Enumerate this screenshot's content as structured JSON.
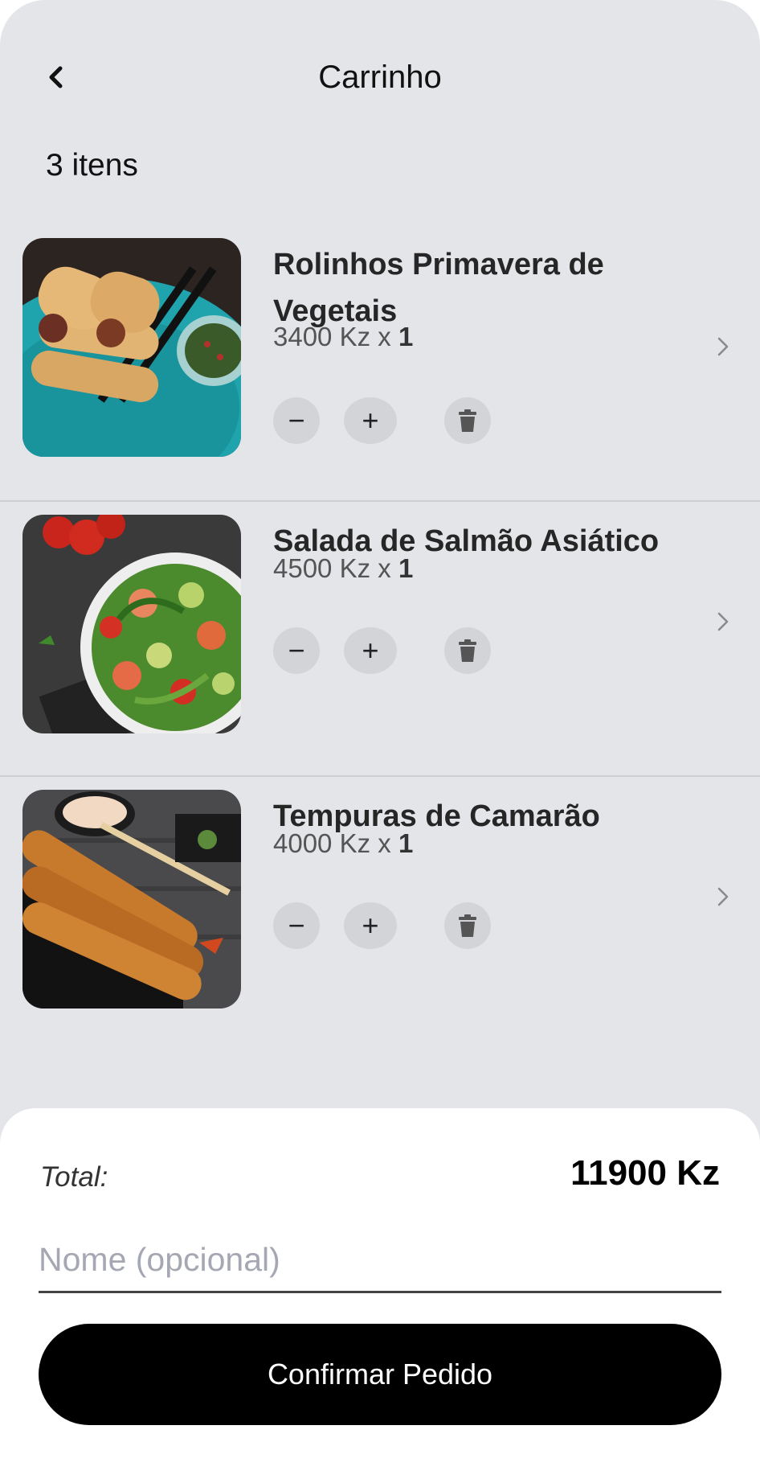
{
  "header": {
    "title": "Carrinho",
    "item_count": "3 itens"
  },
  "items": [
    {
      "name": "Rolinhos Primavera de Vegetais",
      "price": "3400 Kz x ",
      "quantity": "1",
      "minus": "−",
      "plus": "+",
      "image": "spring-rolls-photo"
    },
    {
      "name": "Salada de Salmão Asiático",
      "price": "4500 Kz x ",
      "quantity": "1",
      "minus": "−",
      "plus": "+",
      "image": "salmon-salad-photo"
    },
    {
      "name": "Tempuras de Camarão",
      "price": "4000 Kz x ",
      "quantity": "1",
      "minus": "−",
      "plus": "+",
      "image": "shrimp-tempura-photo"
    }
  ],
  "summary": {
    "total_label": "Total:",
    "total_value": "11900 Kz",
    "name_placeholder": "Nome (opcional)",
    "confirm_label": "Confirmar Pedido"
  },
  "colors": {
    "background": "#e4e5e9",
    "control_bg": "#d3d4d8",
    "button_bg": "#000000"
  }
}
